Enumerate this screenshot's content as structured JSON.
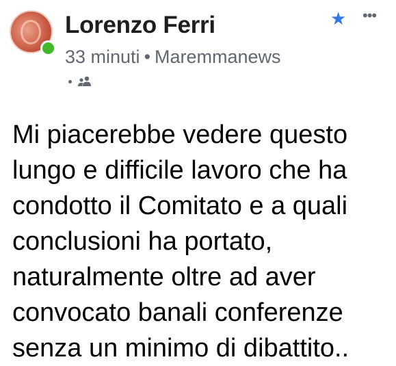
{
  "post": {
    "author": "Lorenzo Ferri",
    "time": "33 minuti",
    "separator": "•",
    "group": "Maremmanews",
    "text": "Mi piacerebbe vedere questo\nlungo e difficile lavoro che ha\ncondotto il Comitato e a quali\nconclusioni ha portato,\nnaturalmente oltre ad aver\nconvocato banali conferenze\nsenza un minimo di dibattito.."
  },
  "icons": {
    "avatar": "profile-picture",
    "online": "online-status-dot",
    "privacy": "friends-icon",
    "favorite": "star-icon",
    "more": "more-options-icon"
  },
  "colors": {
    "star": "#3578e5",
    "online": "#42b72a",
    "meta": "#606770"
  }
}
